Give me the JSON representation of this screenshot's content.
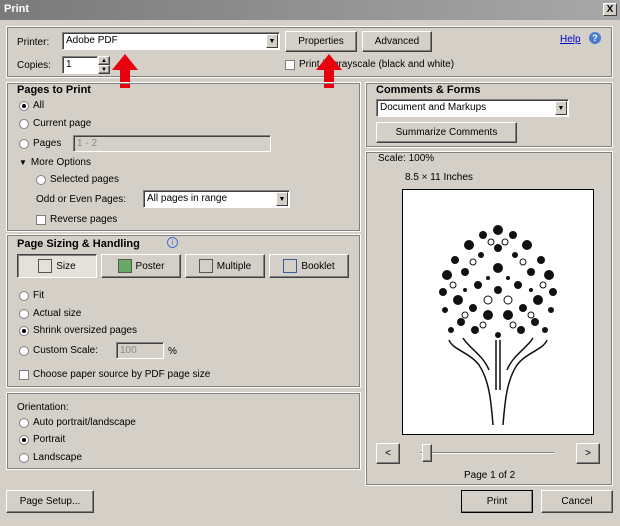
{
  "window": {
    "title": "Print",
    "close": "X"
  },
  "printer": {
    "label": "Printer:",
    "value": "Adobe PDF",
    "properties": "Properties",
    "advanced": "Advanced",
    "help": "Help",
    "copies_label": "Copies:",
    "copies": "1",
    "grayscale": "Print in grayscale (black and white)"
  },
  "pages": {
    "title": "Pages to Print",
    "all": "All",
    "current": "Current page",
    "pages": "Pages",
    "pages_value": "1 - 2",
    "more": "More Options",
    "selected": "Selected pages",
    "odd_even_label": "Odd or Even Pages:",
    "odd_even_value": "All pages in range",
    "reverse": "Reverse pages"
  },
  "sizing": {
    "title": "Page Sizing & Handling",
    "size": "Size",
    "poster": "Poster",
    "multiple": "Multiple",
    "booklet": "Booklet",
    "fit": "Fit",
    "actual": "Actual size",
    "shrink": "Shrink oversized pages",
    "custom": "Custom Scale:",
    "custom_value": "100",
    "percent": "%",
    "paper_source": "Choose paper source by PDF page size"
  },
  "orientation": {
    "title": "Orientation:",
    "auto": "Auto portrait/landscape",
    "portrait": "Portrait",
    "landscape": "Landscape"
  },
  "comments": {
    "title": "Comments & Forms",
    "value": "Document and Markups",
    "summarize": "Summarize Comments"
  },
  "preview": {
    "scale": "Scale: 100%",
    "paper": "8.5 × 11 Inches",
    "page": "Page 1 of 2",
    "prev": "<",
    "next": ">",
    "slider_position": 0
  },
  "footer": {
    "setup": "Page Setup...",
    "print": "Print",
    "cancel": "Cancel"
  },
  "colors": {
    "accent": "#e8000d"
  }
}
